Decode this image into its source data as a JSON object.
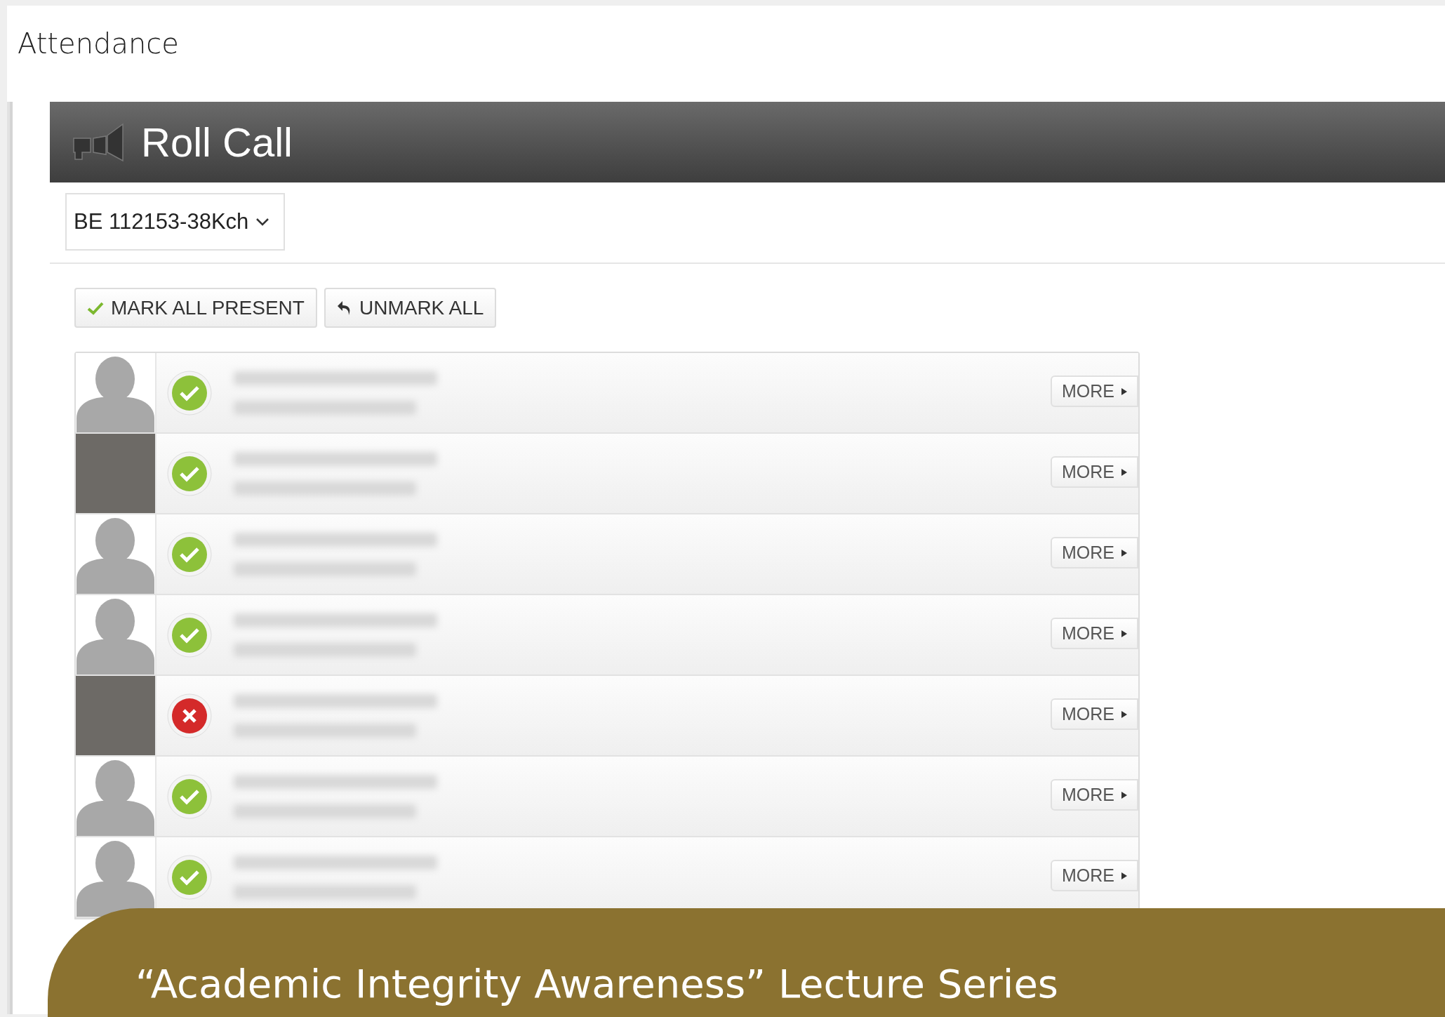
{
  "page_title": "Attendance",
  "panel": {
    "title": "Roll Call"
  },
  "class_select": {
    "value": "BE 112153-38Kch"
  },
  "actions": [
    {
      "label": "MARK ALL PRESENT",
      "kind": "check"
    },
    {
      "label": "UNMARK ALL",
      "kind": "undo"
    }
  ],
  "students": [
    {
      "kind": "silhouette",
      "present": true,
      "more": "MORE"
    },
    {
      "kind": "photo",
      "present": true,
      "more": "MORE"
    },
    {
      "kind": "silhouette",
      "present": true,
      "more": "MORE"
    },
    {
      "kind": "silhouette",
      "present": true,
      "more": "MORE"
    },
    {
      "kind": "photo",
      "present": false,
      "more": "MORE"
    },
    {
      "kind": "silhouette",
      "present": true,
      "more": "MORE"
    },
    {
      "kind": "silhouette",
      "present": true,
      "more": "MORE"
    }
  ],
  "banner": {
    "text": "“Academic Integrity Awareness” Lecture Series"
  }
}
